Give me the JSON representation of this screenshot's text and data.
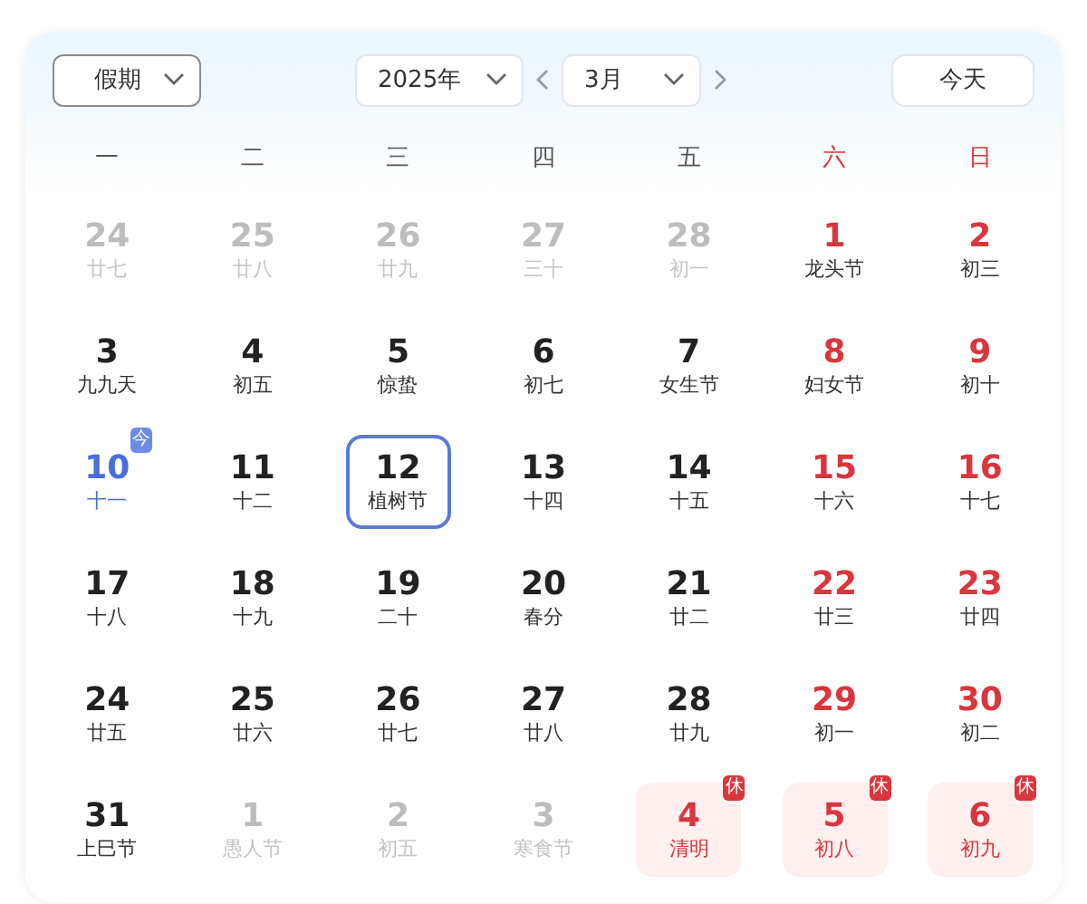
{
  "toolbar": {
    "holiday_select": "假期",
    "year_select": "2025年",
    "month_select": "3月",
    "today_button": "今天"
  },
  "weekdays": [
    {
      "label": "一",
      "weekend": false
    },
    {
      "label": "二",
      "weekend": false
    },
    {
      "label": "三",
      "weekend": false
    },
    {
      "label": "四",
      "weekend": false
    },
    {
      "label": "五",
      "weekend": false
    },
    {
      "label": "六",
      "weekend": true
    },
    {
      "label": "日",
      "weekend": true
    }
  ],
  "days": [
    {
      "day": "24",
      "lunar": "廿七",
      "muted": true,
      "today": false,
      "selected": false
    },
    {
      "day": "25",
      "lunar": "廿八",
      "muted": true,
      "today": false,
      "selected": false
    },
    {
      "day": "26",
      "lunar": "廿九",
      "muted": true,
      "today": false,
      "selected": false
    },
    {
      "day": "27",
      "lunar": "三十",
      "muted": true,
      "today": false,
      "selected": false
    },
    {
      "day": "28",
      "lunar": "初一",
      "muted": true,
      "today": false,
      "selected": false
    },
    {
      "day": "1",
      "lunar": "龙头节",
      "muted": false,
      "weekend": true,
      "today": false,
      "selected": false
    },
    {
      "day": "2",
      "lunar": "初三",
      "muted": false,
      "weekend": true,
      "today": false,
      "selected": false
    },
    {
      "day": "3",
      "lunar": "九九天",
      "muted": false,
      "weekend": false,
      "today": false,
      "selected": false
    },
    {
      "day": "4",
      "lunar": "初五",
      "muted": false,
      "weekend": false,
      "today": false,
      "selected": false
    },
    {
      "day": "5",
      "lunar": "惊蛰",
      "muted": false,
      "weekend": false,
      "today": false,
      "selected": false
    },
    {
      "day": "6",
      "lunar": "初七",
      "muted": false,
      "weekend": false,
      "today": false,
      "selected": false
    },
    {
      "day": "7",
      "lunar": "女生节",
      "muted": false,
      "weekend": false,
      "today": false,
      "selected": false
    },
    {
      "day": "8",
      "lunar": "妇女节",
      "muted": false,
      "weekend": true,
      "today": false,
      "selected": false
    },
    {
      "day": "9",
      "lunar": "初十",
      "muted": false,
      "weekend": true,
      "today": false,
      "selected": false
    },
    {
      "day": "10",
      "lunar": "十一",
      "muted": false,
      "today": true,
      "today_badge": "今",
      "selected": false
    },
    {
      "day": "11",
      "lunar": "十二",
      "muted": false,
      "weekend": false,
      "today": false,
      "selected": false
    },
    {
      "day": "12",
      "lunar": "植树节",
      "muted": false,
      "weekend": false,
      "today": false,
      "selected": true
    },
    {
      "day": "13",
      "lunar": "十四",
      "muted": false,
      "weekend": false,
      "today": false,
      "selected": false
    },
    {
      "day": "14",
      "lunar": "十五",
      "muted": false,
      "weekend": false,
      "today": false,
      "selected": false
    },
    {
      "day": "15",
      "lunar": "十六",
      "muted": false,
      "weekend": true,
      "today": false,
      "selected": false
    },
    {
      "day": "16",
      "lunar": "十七",
      "muted": false,
      "weekend": true,
      "today": false,
      "selected": false
    },
    {
      "day": "17",
      "lunar": "十八",
      "muted": false,
      "weekend": false,
      "today": false,
      "selected": false
    },
    {
      "day": "18",
      "lunar": "十九",
      "muted": false,
      "weekend": false,
      "today": false,
      "selected": false
    },
    {
      "day": "19",
      "lunar": "二十",
      "muted": false,
      "weekend": false,
      "today": false,
      "selected": false
    },
    {
      "day": "20",
      "lunar": "春分",
      "muted": false,
      "weekend": false,
      "today": false,
      "selected": false
    },
    {
      "day": "21",
      "lunar": "廿二",
      "muted": false,
      "weekend": false,
      "today": false,
      "selected": false
    },
    {
      "day": "22",
      "lunar": "廿三",
      "muted": false,
      "weekend": true,
      "today": false,
      "selected": false
    },
    {
      "day": "23",
      "lunar": "廿四",
      "muted": false,
      "weekend": true,
      "today": false,
      "selected": false
    },
    {
      "day": "24",
      "lunar": "廿五",
      "muted": false,
      "weekend": false,
      "today": false,
      "selected": false
    },
    {
      "day": "25",
      "lunar": "廿六",
      "muted": false,
      "weekend": false,
      "today": false,
      "selected": false
    },
    {
      "day": "26",
      "lunar": "廿七",
      "muted": false,
      "weekend": false,
      "today": false,
      "selected": false
    },
    {
      "day": "27",
      "lunar": "廿八",
      "muted": false,
      "weekend": false,
      "today": false,
      "selected": false
    },
    {
      "day": "28",
      "lunar": "廿九",
      "muted": false,
      "weekend": false,
      "today": false,
      "selected": false
    },
    {
      "day": "29",
      "lunar": "初一",
      "muted": false,
      "weekend": true,
      "today": false,
      "selected": false
    },
    {
      "day": "30",
      "lunar": "初二",
      "muted": false,
      "weekend": true,
      "today": false,
      "selected": false
    },
    {
      "day": "31",
      "lunar": "上巳节",
      "muted": false,
      "weekend": false,
      "today": false,
      "selected": false
    },
    {
      "day": "1",
      "lunar": "愚人节",
      "muted": true,
      "today": false,
      "selected": false
    },
    {
      "day": "2",
      "lunar": "初五",
      "muted": true,
      "today": false,
      "selected": false
    },
    {
      "day": "3",
      "lunar": "寒食节",
      "muted": true,
      "today": false,
      "selected": false
    },
    {
      "day": "4",
      "lunar": "清明",
      "muted": false,
      "today": false,
      "selected": false,
      "rest_badge": "休"
    },
    {
      "day": "5",
      "lunar": "初八",
      "muted": false,
      "today": false,
      "selected": false,
      "rest_badge": "休"
    },
    {
      "day": "6",
      "lunar": "初九",
      "muted": false,
      "today": false,
      "selected": false,
      "rest_badge": "休"
    }
  ]
}
